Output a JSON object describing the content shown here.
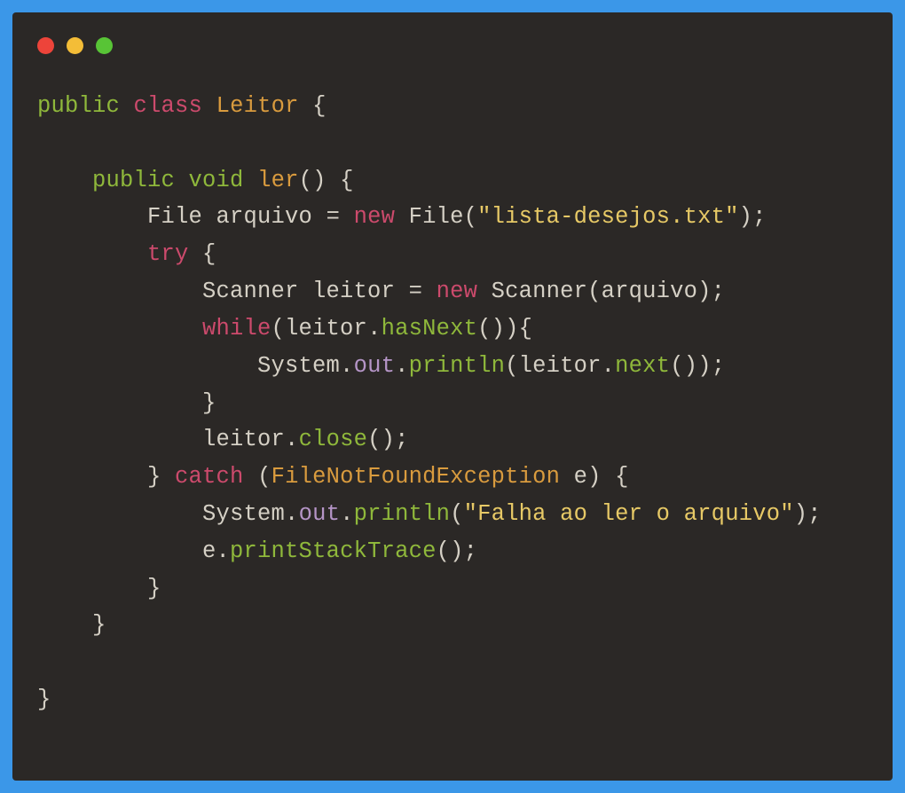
{
  "traffic_lights": {
    "red": "#ed443a",
    "yellow": "#f4bd37",
    "green": "#58c436"
  },
  "code": {
    "line1": {
      "public": "public",
      "class": "class",
      "classname": "Leitor",
      "brace": " {"
    },
    "line3": {
      "indent": "    ",
      "public": "public",
      "void": "void",
      "method": "ler",
      "parens": "() {"
    },
    "line4": {
      "indent": "        ",
      "file_decl": "File arquivo = ",
      "new": "new",
      "file_call": " File(",
      "str": "\"lista-desejos.txt\"",
      "end": ");"
    },
    "line5": {
      "indent": "        ",
      "try": "try",
      "brace": " {"
    },
    "line6": {
      "indent": "            ",
      "scanner_decl": "Scanner leitor = ",
      "new": "new",
      "scanner_call": " Scanner(arquivo);"
    },
    "line7": {
      "indent": "            ",
      "while": "while",
      "paren_open": "(leitor.",
      "hasnext": "hasNext",
      "paren_close": "()){"
    },
    "line8": {
      "indent": "                ",
      "system": "System.",
      "out": "out",
      "dot": ".",
      "println": "println",
      "args_open": "(leitor.",
      "next": "next",
      "args_close": "());"
    },
    "line9": {
      "indent": "            ",
      "brace": "}"
    },
    "line10": {
      "indent": "            ",
      "leitor": "leitor.",
      "close": "close",
      "end": "();"
    },
    "line11": {
      "indent": "        ",
      "brace": "} ",
      "catch": "catch",
      "paren_open": " (",
      "exception": "FileNotFoundException",
      "var": " e) {"
    },
    "line12": {
      "indent": "            ",
      "system": "System.",
      "out": "out",
      "dot": ".",
      "println": "println",
      "paren_open": "(",
      "str": "\"Falha ao ler o arquivo\"",
      "paren_close": ");"
    },
    "line13": {
      "indent": "            ",
      "e": "e.",
      "pst": "printStackTrace",
      "end": "();"
    },
    "line14": {
      "indent": "        ",
      "brace": "}"
    },
    "line15": {
      "indent": "    ",
      "brace": "}"
    },
    "line17": {
      "brace": "}"
    }
  }
}
